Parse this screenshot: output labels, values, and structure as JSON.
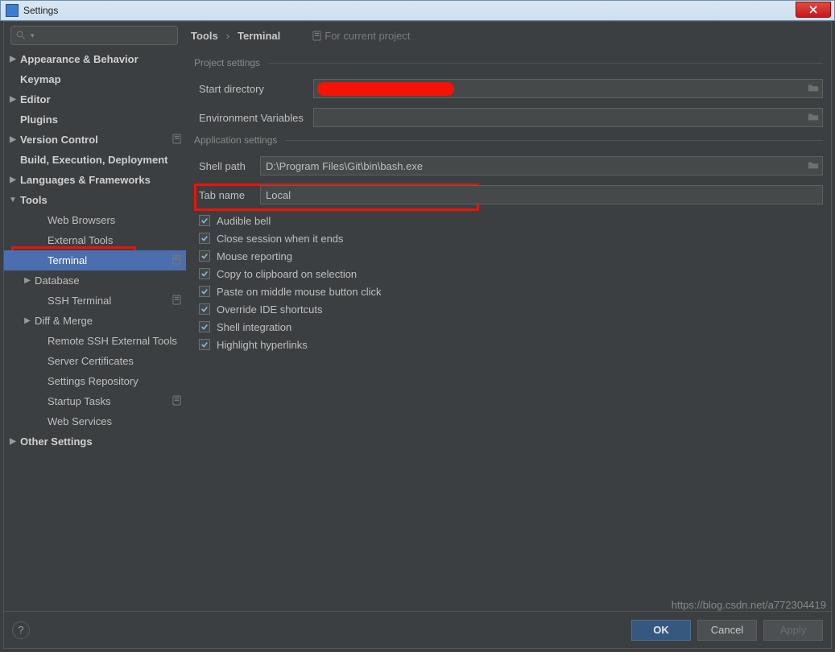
{
  "window": {
    "title": "Settings"
  },
  "breadcrumb": {
    "root": "Tools",
    "sep": "›",
    "leaf": "Terminal"
  },
  "scope": {
    "label": "For current project"
  },
  "sidebar": {
    "items": [
      {
        "label": "Appearance & Behavior",
        "level": 1,
        "arrow": "▶"
      },
      {
        "label": "Keymap",
        "level": 1
      },
      {
        "label": "Editor",
        "level": 1,
        "arrow": "▶"
      },
      {
        "label": "Plugins",
        "level": 1
      },
      {
        "label": "Version Control",
        "level": 1,
        "arrow": "▶",
        "proj": true
      },
      {
        "label": "Build, Execution, Deployment",
        "level": 1
      },
      {
        "label": "Languages & Frameworks",
        "level": 1,
        "arrow": "▶"
      },
      {
        "label": "Tools",
        "level": 1,
        "arrow": "▼"
      },
      {
        "label": "Web Browsers",
        "level": 3
      },
      {
        "label": "External Tools",
        "level": 3
      },
      {
        "label": "Terminal",
        "level": 3,
        "selected": true,
        "proj": true
      },
      {
        "label": "Database",
        "level": 2,
        "arrow": "▶"
      },
      {
        "label": "SSH Terminal",
        "level": 3,
        "proj": true
      },
      {
        "label": "Diff & Merge",
        "level": 2,
        "arrow": "▶"
      },
      {
        "label": "Remote SSH External Tools",
        "level": 3
      },
      {
        "label": "Server Certificates",
        "level": 3
      },
      {
        "label": "Settings Repository",
        "level": 3
      },
      {
        "label": "Startup Tasks",
        "level": 3,
        "proj": true
      },
      {
        "label": "Web Services",
        "level": 3
      },
      {
        "label": "Other Settings",
        "level": 1,
        "arrow": "▶"
      }
    ]
  },
  "sections": {
    "project": "Project settings",
    "application": "Application settings"
  },
  "fields": {
    "start_dir": {
      "label": "Start directory",
      "value": ""
    },
    "env_vars": {
      "label": "Environment Variables",
      "value": ""
    },
    "shell_path": {
      "label": "Shell path",
      "value": "D:\\Program Files\\Git\\bin\\bash.exe"
    },
    "tab_name": {
      "label": "Tab name",
      "value": "Local"
    }
  },
  "checks": [
    {
      "label": "Audible bell"
    },
    {
      "label": "Close session when it ends"
    },
    {
      "label": "Mouse reporting"
    },
    {
      "label": "Copy to clipboard on selection"
    },
    {
      "label": "Paste on middle mouse button click"
    },
    {
      "label": "Override IDE shortcuts"
    },
    {
      "label": "Shell integration"
    },
    {
      "label": "Highlight hyperlinks"
    }
  ],
  "footer": {
    "ok": "OK",
    "cancel": "Cancel",
    "apply": "Apply"
  },
  "watermark": "https://blog.csdn.net/a772304419"
}
